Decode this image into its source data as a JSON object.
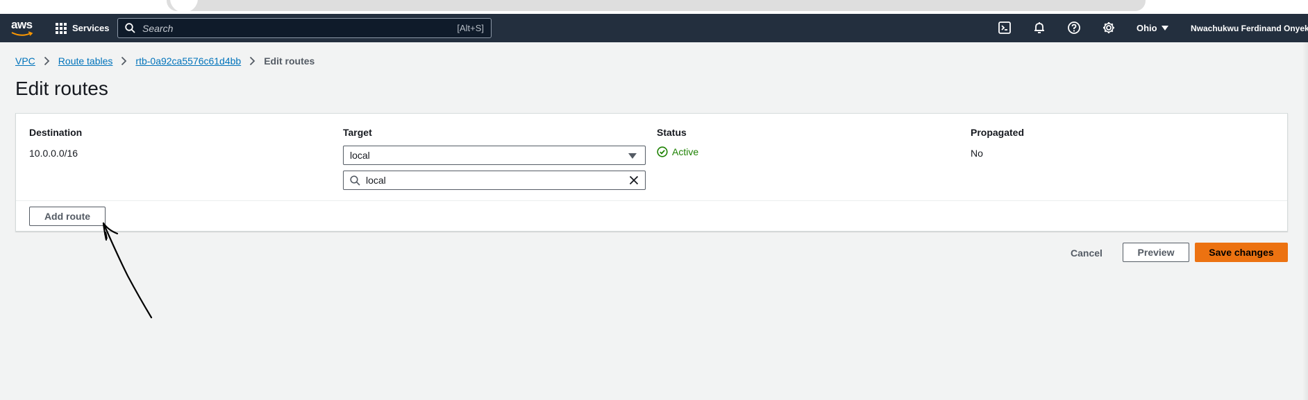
{
  "nav": {
    "logo_text": "aws",
    "services_label": "Services",
    "search_placeholder": "Search",
    "search_shortcut": "[Alt+S]",
    "region": "Ohio",
    "user_name": "Nwachukwu Ferdinand Onyeka",
    "icons": [
      "cloudshell-icon",
      "bell-icon",
      "help-icon",
      "gear-icon"
    ]
  },
  "breadcrumb": {
    "items": [
      "VPC",
      "Route tables",
      "rtb-0a92ca5576c61d4bb"
    ],
    "current": "Edit routes"
  },
  "page": {
    "title": "Edit routes"
  },
  "routes": {
    "headers": {
      "destination": "Destination",
      "target": "Target",
      "status": "Status",
      "propagated": "Propagated"
    },
    "rows": [
      {
        "destination": "10.0.0.0/16",
        "target": "local",
        "target_filter": "local",
        "status": "Active",
        "propagated": "No"
      }
    ],
    "add_route_label": "Add route"
  },
  "actions": {
    "cancel": "Cancel",
    "preview": "Preview",
    "save": "Save changes"
  },
  "colors": {
    "nav_bg": "#232f3e",
    "link": "#0073bb",
    "status_active": "#1d8102",
    "primary": "#ec7211",
    "page_bg": "#f2f3f3"
  }
}
